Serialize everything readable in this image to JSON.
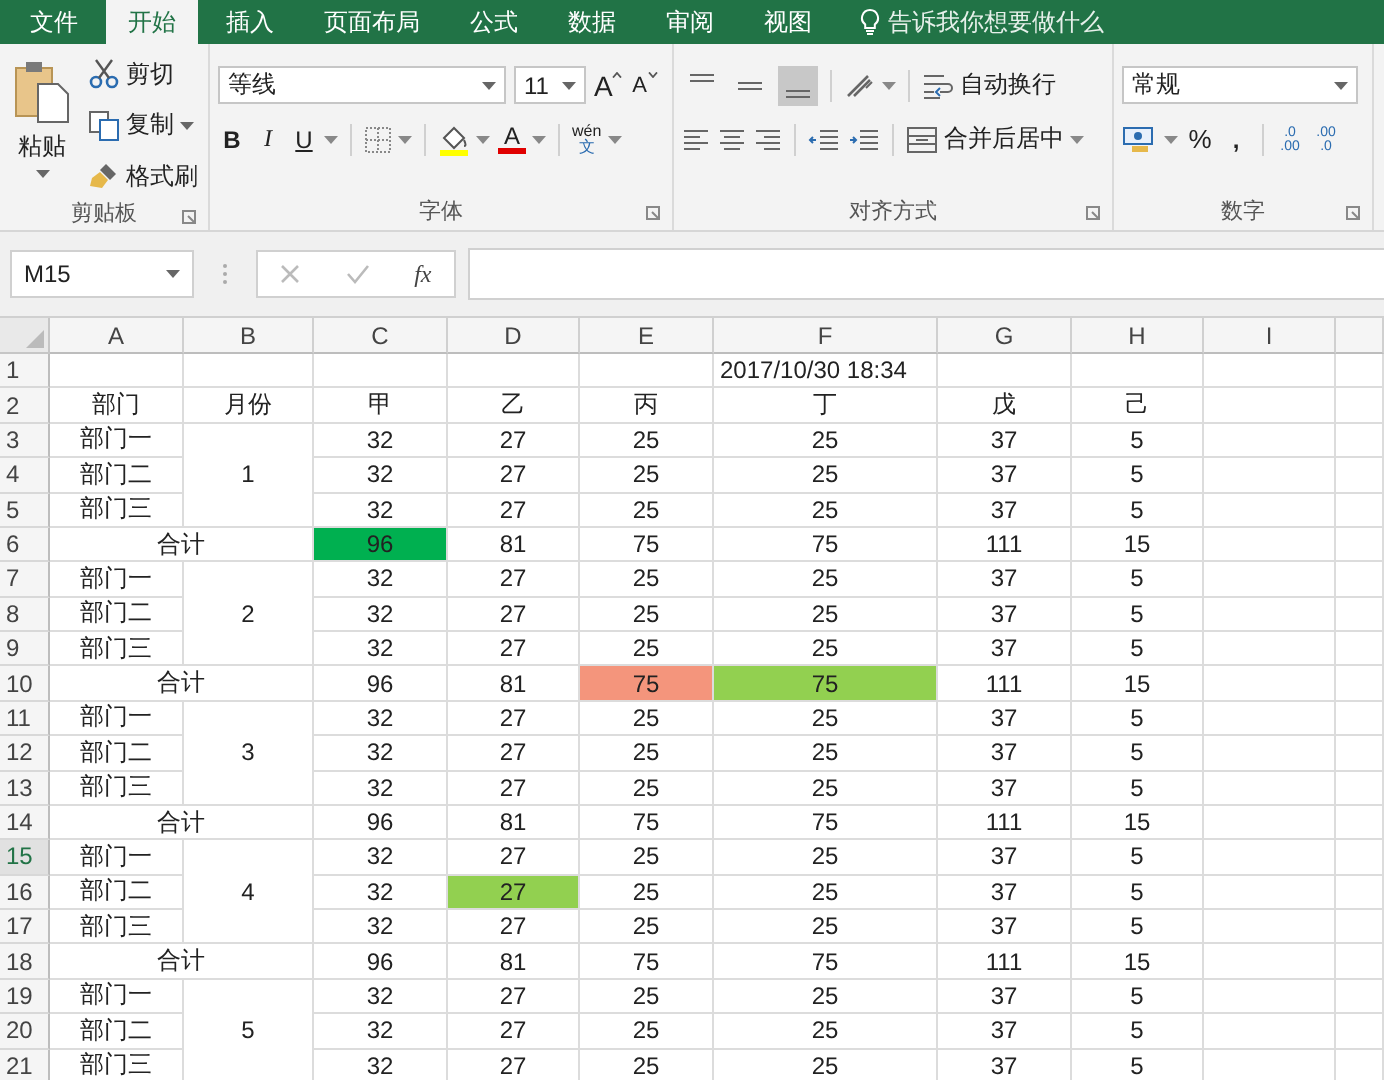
{
  "tabs": [
    {
      "label": "文件",
      "selected": false
    },
    {
      "label": "开始",
      "selected": true
    },
    {
      "label": "插入",
      "selected": false
    },
    {
      "label": "页面布局",
      "selected": false
    },
    {
      "label": "公式",
      "selected": false
    },
    {
      "label": "数据",
      "selected": false
    },
    {
      "label": "审阅",
      "selected": false
    },
    {
      "label": "视图",
      "selected": false
    }
  ],
  "tell_me": "告诉我你想要做什么",
  "ribbon": {
    "clipboard": {
      "paste": "粘贴",
      "cut": "剪切",
      "copy": "复制",
      "format_painter": "格式刷",
      "label": "剪贴板"
    },
    "font": {
      "font_name": "等线",
      "font_size": "11",
      "grow": "A",
      "shrink": "A",
      "bold": "B",
      "italic": "I",
      "underline": "U",
      "font_color": "A",
      "phonetic_top": "wén",
      "phonetic_bottom": "文",
      "label": "字体"
    },
    "alignment": {
      "vertical": [
        {
          "kind": "top",
          "selected": false
        },
        {
          "kind": "middle",
          "selected": false
        },
        {
          "kind": "bottom",
          "selected": true
        }
      ],
      "wrap_text": "自动换行",
      "merge_center": "合并后居中",
      "label": "对齐方式"
    },
    "number": {
      "format": "常规",
      "percent": "%",
      "comma": ",",
      "increase_decimal": [
        ".0",
        ".00"
      ],
      "decrease_decimal": [
        ".00",
        ".0"
      ],
      "label": "数字"
    }
  },
  "name_box": "M15",
  "function_symbol": "fx",
  "sheet": {
    "columns": [
      "A",
      "B",
      "C",
      "D",
      "E",
      "F",
      "G",
      "H",
      "I"
    ],
    "row_numbers": [
      {
        "label": "1",
        "selected": false
      },
      {
        "label": "2",
        "selected": false
      },
      {
        "label": "3",
        "selected": false
      },
      {
        "label": "4",
        "selected": false
      },
      {
        "label": "5",
        "selected": false
      },
      {
        "label": "6",
        "selected": false
      },
      {
        "label": "7",
        "selected": false
      },
      {
        "label": "8",
        "selected": false
      },
      {
        "label": "9",
        "selected": false
      },
      {
        "label": "10",
        "selected": false
      },
      {
        "label": "11",
        "selected": false
      },
      {
        "label": "12",
        "selected": false
      },
      {
        "label": "13",
        "selected": false
      },
      {
        "label": "14",
        "selected": false
      },
      {
        "label": "15",
        "selected": true
      },
      {
        "label": "16",
        "selected": false
      },
      {
        "label": "17",
        "selected": false
      },
      {
        "label": "18",
        "selected": false
      },
      {
        "label": "19",
        "selected": false
      },
      {
        "label": "20",
        "selected": false
      },
      {
        "label": "21",
        "selected": false
      }
    ],
    "date": "2017/10/30 18:34",
    "headers": [
      "部门",
      "月份",
      "甲",
      "乙",
      "丙",
      "丁",
      "戊",
      "己"
    ],
    "blocks": [
      {
        "month": "1",
        "rows": [
          {
            "dept": "部门一",
            "cells": [
              {
                "text": "32"
              },
              {
                "text": "27"
              },
              {
                "text": "25"
              },
              {
                "text": "25"
              },
              {
                "text": "37"
              },
              {
                "text": "5"
              }
            ]
          },
          {
            "dept": "部门二",
            "cells": [
              {
                "text": "32"
              },
              {
                "text": "27"
              },
              {
                "text": "25"
              },
              {
                "text": "25"
              },
              {
                "text": "37"
              },
              {
                "text": "5"
              }
            ]
          },
          {
            "dept": "部门三",
            "cells": [
              {
                "text": "32"
              },
              {
                "text": "27"
              },
              {
                "text": "25"
              },
              {
                "text": "25"
              },
              {
                "text": "37"
              },
              {
                "text": "5"
              }
            ]
          }
        ],
        "total": {
          "label": "合计",
          "cells": [
            {
              "text": "96",
              "color": "#00b050"
            },
            {
              "text": "81"
            },
            {
              "text": "75"
            },
            {
              "text": "75"
            },
            {
              "text": "111"
            },
            {
              "text": "15"
            }
          ]
        }
      },
      {
        "month": "2",
        "rows": [
          {
            "dept": "部门一",
            "cells": [
              {
                "text": "32"
              },
              {
                "text": "27"
              },
              {
                "text": "25"
              },
              {
                "text": "25"
              },
              {
                "text": "37"
              },
              {
                "text": "5"
              }
            ]
          },
          {
            "dept": "部门二",
            "cells": [
              {
                "text": "32"
              },
              {
                "text": "27"
              },
              {
                "text": "25"
              },
              {
                "text": "25"
              },
              {
                "text": "37"
              },
              {
                "text": "5"
              }
            ]
          },
          {
            "dept": "部门三",
            "cells": [
              {
                "text": "32"
              },
              {
                "text": "27"
              },
              {
                "text": "25"
              },
              {
                "text": "25"
              },
              {
                "text": "37"
              },
              {
                "text": "5"
              }
            ]
          }
        ],
        "total": {
          "label": "合计",
          "cells": [
            {
              "text": "96"
            },
            {
              "text": "81"
            },
            {
              "text": "75",
              "color": "#f4957c"
            },
            {
              "text": "75",
              "color": "#92d050"
            },
            {
              "text": "111"
            },
            {
              "text": "15"
            }
          ]
        }
      },
      {
        "month": "3",
        "rows": [
          {
            "dept": "部门一",
            "cells": [
              {
                "text": "32"
              },
              {
                "text": "27"
              },
              {
                "text": "25"
              },
              {
                "text": "25"
              },
              {
                "text": "37"
              },
              {
                "text": "5"
              }
            ]
          },
          {
            "dept": "部门二",
            "cells": [
              {
                "text": "32"
              },
              {
                "text": "27"
              },
              {
                "text": "25"
              },
              {
                "text": "25"
              },
              {
                "text": "37"
              },
              {
                "text": "5"
              }
            ]
          },
          {
            "dept": "部门三",
            "cells": [
              {
                "text": "32"
              },
              {
                "text": "27"
              },
              {
                "text": "25"
              },
              {
                "text": "25"
              },
              {
                "text": "37"
              },
              {
                "text": "5"
              }
            ]
          }
        ],
        "total": {
          "label": "合计",
          "cells": [
            {
              "text": "96"
            },
            {
              "text": "81"
            },
            {
              "text": "75"
            },
            {
              "text": "75"
            },
            {
              "text": "111"
            },
            {
              "text": "15"
            }
          ]
        }
      },
      {
        "month": "4",
        "rows": [
          {
            "dept": "部门一",
            "cells": [
              {
                "text": "32"
              },
              {
                "text": "27"
              },
              {
                "text": "25"
              },
              {
                "text": "25"
              },
              {
                "text": "37"
              },
              {
                "text": "5"
              }
            ]
          },
          {
            "dept": "部门二",
            "cells": [
              {
                "text": "32"
              },
              {
                "text": "27",
                "color": "#92d050"
              },
              {
                "text": "25"
              },
              {
                "text": "25"
              },
              {
                "text": "37"
              },
              {
                "text": "5"
              }
            ]
          },
          {
            "dept": "部门三",
            "cells": [
              {
                "text": "32"
              },
              {
                "text": "27"
              },
              {
                "text": "25"
              },
              {
                "text": "25"
              },
              {
                "text": "37"
              },
              {
                "text": "5"
              }
            ]
          }
        ],
        "total": {
          "label": "合计",
          "cells": [
            {
              "text": "96"
            },
            {
              "text": "81"
            },
            {
              "text": "75"
            },
            {
              "text": "75"
            },
            {
              "text": "111"
            },
            {
              "text": "15"
            }
          ]
        }
      },
      {
        "month": "5",
        "rows": [
          {
            "dept": "部门一",
            "cells": [
              {
                "text": "32"
              },
              {
                "text": "27"
              },
              {
                "text": "25"
              },
              {
                "text": "25"
              },
              {
                "text": "37"
              },
              {
                "text": "5"
              }
            ]
          },
          {
            "dept": "部门二",
            "cells": [
              {
                "text": "32"
              },
              {
                "text": "27"
              },
              {
                "text": "25"
              },
              {
                "text": "25"
              },
              {
                "text": "37"
              },
              {
                "text": "5"
              }
            ]
          },
          {
            "dept": "部门三",
            "cells": [
              {
                "text": "32"
              },
              {
                "text": "27"
              },
              {
                "text": "25"
              },
              {
                "text": "25"
              },
              {
                "text": "37"
              },
              {
                "text": "5"
              }
            ]
          }
        ]
      }
    ]
  }
}
